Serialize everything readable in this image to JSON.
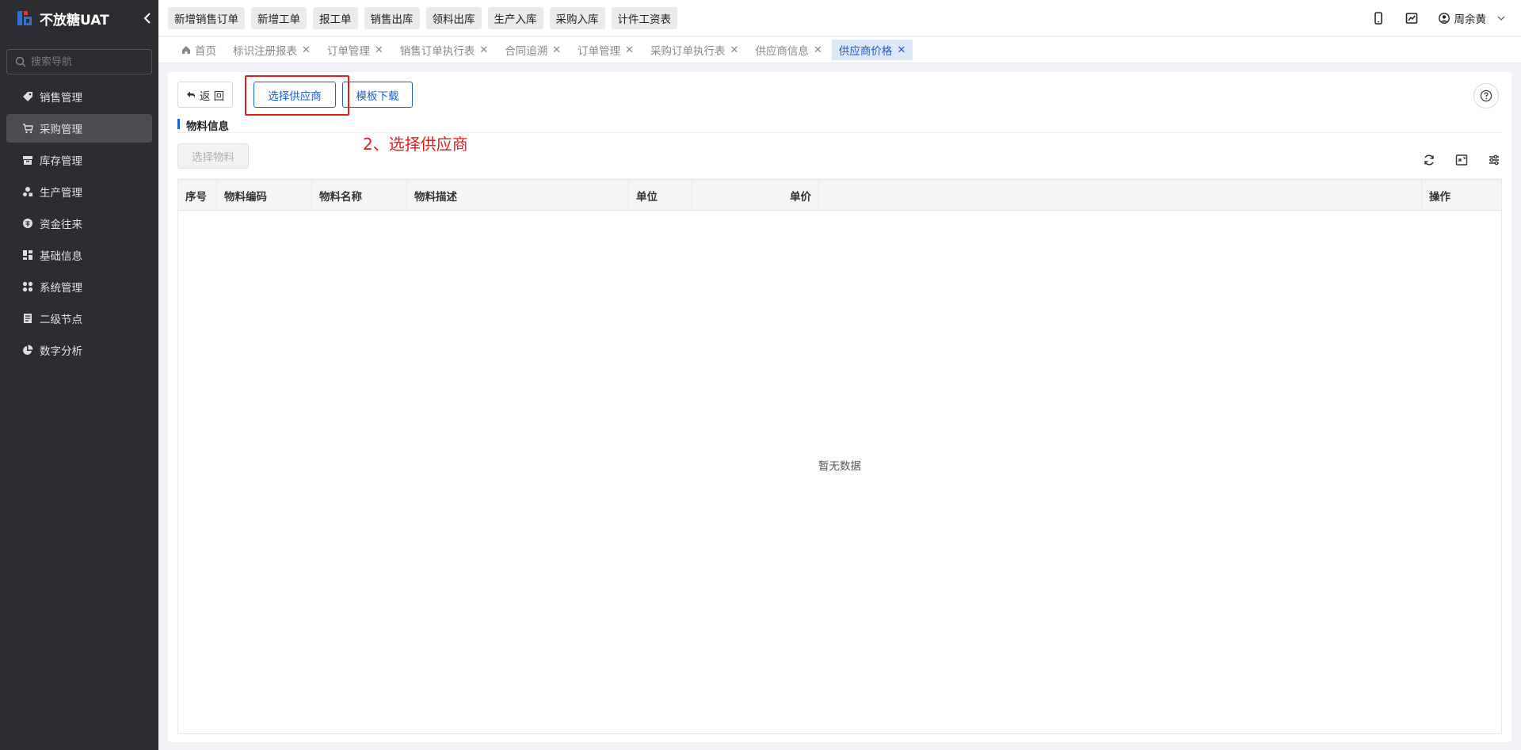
{
  "app": {
    "title": "不放糖UAT"
  },
  "sidebar": {
    "search_placeholder": "搜索导航",
    "items": [
      {
        "label": "销售管理",
        "icon": "tag-icon"
      },
      {
        "label": "采购管理",
        "icon": "cart-icon",
        "active": true
      },
      {
        "label": "库存管理",
        "icon": "warehouse-icon"
      },
      {
        "label": "生产管理",
        "icon": "production-icon"
      },
      {
        "label": "资金往来",
        "icon": "money-icon"
      },
      {
        "label": "基础信息",
        "icon": "grid-icon"
      },
      {
        "label": "系统管理",
        "icon": "apps-icon"
      },
      {
        "label": "二级节点",
        "icon": "document-icon"
      },
      {
        "label": "数字分析",
        "icon": "pie-chart-icon"
      }
    ]
  },
  "topbar": {
    "quick_buttons": [
      "新增销售订单",
      "新增工单",
      "报工单",
      "销售出库",
      "领料出库",
      "生产入库",
      "采购入库",
      "计件工资表"
    ],
    "user_name": "周余黄"
  },
  "tabs": [
    {
      "label": "首页",
      "closable": false
    },
    {
      "label": "标识注册报表",
      "closable": true
    },
    {
      "label": "订单管理",
      "closable": true
    },
    {
      "label": "销售订单执行表",
      "closable": true
    },
    {
      "label": "合同追溯",
      "closable": true
    },
    {
      "label": "订单管理",
      "closable": true
    },
    {
      "label": "采购订单执行表",
      "closable": true
    },
    {
      "label": "供应商信息",
      "closable": true
    },
    {
      "label": "供应商价格",
      "closable": true,
      "active": true
    }
  ],
  "main": {
    "back_label": "返 回",
    "select_supplier_label": "选择供应商",
    "template_download_label": "模板下载",
    "section_title": "物料信息",
    "annotation": "2、选择供应商",
    "select_material_label": "选择物料",
    "table": {
      "columns": [
        "序号",
        "物料编码",
        "物料名称",
        "物料描述",
        "单位",
        "单价",
        "",
        "操作"
      ],
      "empty_text": "暂无数据"
    }
  },
  "colors": {
    "accent": "#1f5fc9",
    "annotation": "#e51c1c",
    "sidebar_bg": "#2b2d30"
  }
}
